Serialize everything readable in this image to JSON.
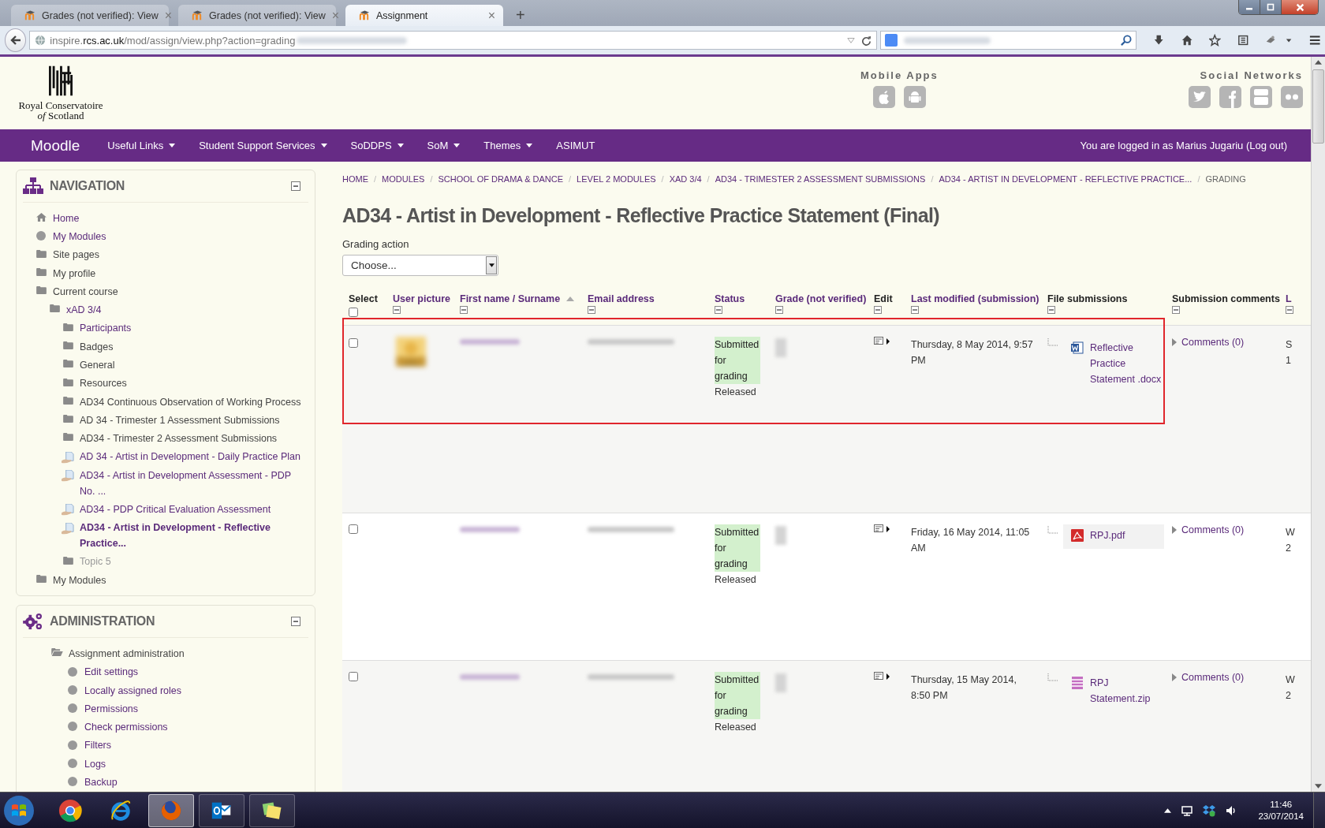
{
  "browser": {
    "tabs": [
      {
        "title": "Grades (not verified): View",
        "selected": false
      },
      {
        "title": "Grades (not verified): View",
        "selected": false
      },
      {
        "title": "Assignment",
        "selected": true
      }
    ],
    "new_tab": "+",
    "close": "×",
    "address_host_pre": "inspire.",
    "address_host": "rcs.ac.uk",
    "address_path": "/mod/assign/view.php?action=grading"
  },
  "header": {
    "logo_lines": [
      "Royal Conservatoire",
      "*of* Scotland"
    ],
    "mobile_title": "Mobile Apps",
    "mobile_apps": [
      {
        "kind": "apple"
      },
      {
        "kind": "android"
      }
    ],
    "social_title": "Social Networks",
    "social": [
      {
        "kind": "twitter"
      },
      {
        "kind": "facebook"
      },
      {
        "kind": "youtube"
      },
      {
        "kind": "flickr"
      }
    ]
  },
  "navbar": {
    "brand": "Moodle",
    "items": [
      {
        "label": "Useful Links",
        "dropdown": true
      },
      {
        "label": "Student Support Services",
        "dropdown": true
      },
      {
        "label": "SoDDPS",
        "dropdown": true
      },
      {
        "label": "SoM",
        "dropdown": true
      },
      {
        "label": "Themes",
        "dropdown": true
      },
      {
        "label": "ASIMUT",
        "dropdown": false
      }
    ],
    "login": "You are logged in as Marius Jugariu (Log out)"
  },
  "navigation": {
    "title": "NAVIGATION",
    "items": [
      {
        "label": "Home",
        "kind": "home",
        "link": true,
        "current": false,
        "dimmed": false
      },
      {
        "label": "My Modules",
        "kind": "circle",
        "link": true,
        "current": false,
        "dimmed": false
      },
      {
        "label": "Site pages",
        "kind": "folder",
        "link": false,
        "current": false,
        "dimmed": false
      },
      {
        "label": "My profile",
        "kind": "folder",
        "link": false,
        "current": false,
        "dimmed": false
      },
      {
        "label": "Current course",
        "kind": "folder",
        "link": false,
        "current": false,
        "dimmed": false,
        "children": [
          {
            "label": "xAD 3/4",
            "kind": "folder",
            "link": true,
            "current": false,
            "dimmed": false,
            "children": [
              {
                "label": "Participants",
                "kind": "folder",
                "link": true,
                "current": false,
                "dimmed": false
              },
              {
                "label": "Badges",
                "kind": "folder",
                "link": false,
                "current": false,
                "dimmed": false
              },
              {
                "label": "General",
                "kind": "folder",
                "link": false,
                "current": false,
                "dimmed": false
              },
              {
                "label": "Resources",
                "kind": "folder",
                "link": false,
                "current": false,
                "dimmed": false
              },
              {
                "label": "AD34 Continuous Observation of Working Process",
                "kind": "folder",
                "link": false,
                "current": false,
                "dimmed": false
              },
              {
                "label": "AD 34 - Trimester 1 Assessment Submissions",
                "kind": "folder",
                "link": false,
                "current": false,
                "dimmed": false
              },
              {
                "label": "AD34 - Trimester 2 Assessment Submissions",
                "kind": "folder",
                "link": false,
                "current": false,
                "dimmed": false
              },
              {
                "label": "AD 34 - Artist in Development - Daily Practice Plan",
                "kind": "assign",
                "link": true,
                "current": false,
                "dimmed": false
              },
              {
                "label": "AD34 - Artist in Development Assessment - PDP No. ...",
                "kind": "assign",
                "link": true,
                "current": false,
                "dimmed": false
              },
              {
                "label": "AD34 - PDP Critical Evaluation Assessment",
                "kind": "assign",
                "link": true,
                "current": false,
                "dimmed": false
              },
              {
                "label": "AD34 - Artist in Development - Reflective Practice...",
                "kind": "assign",
                "link": true,
                "current": true,
                "dimmed": false
              },
              {
                "label": "Topic 5",
                "kind": "folder",
                "link": false,
                "current": false,
                "dimmed": true
              }
            ]
          }
        ]
      },
      {
        "label": "My Modules",
        "kind": "folder",
        "link": false,
        "current": false,
        "dimmed": false
      }
    ]
  },
  "administration": {
    "title": "ADMINISTRATION",
    "items": [
      {
        "label": "Assignment administration",
        "kind": "folder-open",
        "link": false,
        "current": false,
        "dimmed": false,
        "children": [
          {
            "label": "Edit settings",
            "kind": "circle",
            "link": true,
            "current": false,
            "dimmed": false
          },
          {
            "label": "Locally assigned roles",
            "kind": "circle",
            "link": true,
            "current": false,
            "dimmed": false
          },
          {
            "label": "Permissions",
            "kind": "circle",
            "link": true,
            "current": false,
            "dimmed": false
          },
          {
            "label": "Check permissions",
            "kind": "circle",
            "link": true,
            "current": false,
            "dimmed": false
          },
          {
            "label": "Filters",
            "kind": "circle",
            "link": true,
            "current": false,
            "dimmed": false
          },
          {
            "label": "Logs",
            "kind": "circle",
            "link": true,
            "current": false,
            "dimmed": false
          },
          {
            "label": "Backup",
            "kind": "circle",
            "link": true,
            "current": false,
            "dimmed": false
          }
        ]
      }
    ]
  },
  "breadcrumb": [
    {
      "label": "HOME",
      "link": true
    },
    {
      "separator": "/",
      "label": "MODULES",
      "link": true
    },
    {
      "separator": "/",
      "label": "SCHOOL OF DRAMA & DANCE",
      "link": true
    },
    {
      "separator": "/",
      "label": "LEVEL 2 MODULES",
      "link": true
    },
    {
      "separator": "/",
      "label": "XAD 3/4",
      "link": true
    },
    {
      "separator": "/",
      "label": "AD34 - TRIMESTER 2 ASSESSMENT SUBMISSIONS",
      "link": true
    },
    {
      "separator": "/",
      "label": "AD34 - ARTIST IN DEVELOPMENT - REFLECTIVE PRACTICE...",
      "link": true
    },
    {
      "separator": "/",
      "label": "GRADING",
      "link": false
    }
  ],
  "title": "AD34 - Artist in Development - Reflective Practice Statement (Final)",
  "grading_action": {
    "label": "Grading action",
    "value": "Choose..."
  },
  "table": {
    "select_all_checked": false,
    "columns": [
      {
        "label": "Select",
        "link": false,
        "sorted": false
      },
      {
        "label": "User picture",
        "link": true,
        "sorted": false
      },
      {
        "label": "First name / Surname",
        "link": true,
        "sorted": true
      },
      {
        "label": "Email address",
        "link": true,
        "sorted": false
      },
      {
        "label": "Status",
        "link": true,
        "sorted": false
      },
      {
        "label": "Grade (not verified)",
        "link": true,
        "sorted": false
      },
      {
        "label": "Edit",
        "link": false,
        "sorted": false
      },
      {
        "label": "Last modified (submission)",
        "link": true,
        "sorted": false
      },
      {
        "label": "File submissions",
        "link": false,
        "sorted": false
      },
      {
        "label": "Submission comments",
        "link": false,
        "sorted": false
      },
      {
        "label": "L",
        "link": true,
        "sorted": false
      }
    ],
    "rows": [
      {
        "highlighted": true,
        "checked": false,
        "avatar": true,
        "status": "Submitted for grading",
        "released": "Released",
        "modified": "Thursday, 8 May 2014, 9:57 PM",
        "file": {
          "kind": "word",
          "name": "Reflective Practice Statement .docx"
        },
        "comments": "Comments (0)",
        "last": [
          "S",
          "1"
        ]
      },
      {
        "highlighted": false,
        "checked": false,
        "avatar": false,
        "status": "Submitted for grading",
        "released": "Released",
        "modified": "Friday, 16 May 2014, 11:05 AM",
        "file": {
          "kind": "pdf",
          "name": "RPJ.pdf"
        },
        "comments": "Comments (0)",
        "last": [
          "W",
          "2"
        ]
      },
      {
        "highlighted": false,
        "checked": false,
        "avatar": false,
        "status": "Submitted for grading",
        "released": "Released",
        "modified": "Thursday, 15 May 2014, 8:50 PM",
        "file": {
          "kind": "zip",
          "name": "RPJ Statement.zip"
        },
        "comments": "Comments (0)",
        "last": [
          "W",
          "2"
        ]
      }
    ]
  },
  "taskbar": {
    "apps": [
      {
        "kind": "chrome",
        "active": false
      },
      {
        "kind": "ie",
        "active": false
      },
      {
        "kind": "firefox",
        "active": true
      },
      {
        "kind": "outlook",
        "active": false
      },
      {
        "kind": "notes",
        "active": false
      }
    ],
    "time": "11:46",
    "date": "23/07/2014"
  }
}
